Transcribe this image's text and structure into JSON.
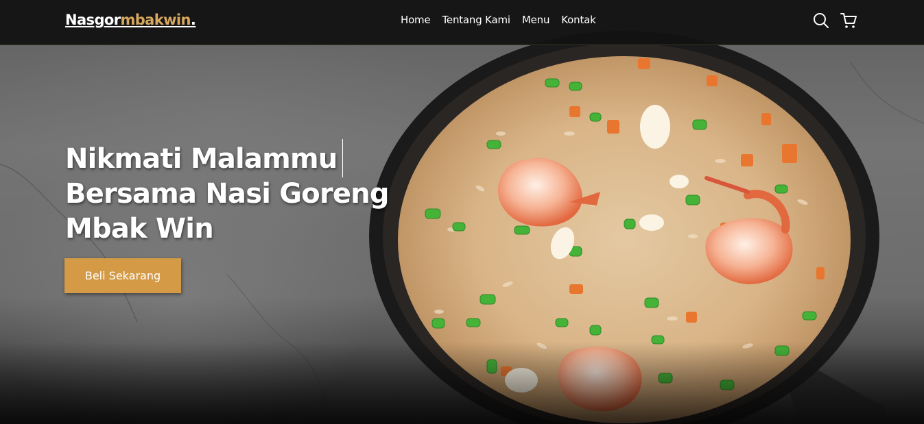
{
  "brand": {
    "primary": "Nasgor",
    "accent": "mbakwin",
    "dot": "."
  },
  "nav": {
    "items": [
      "Home",
      "Tentang Kami",
      "Menu",
      "Kontak"
    ]
  },
  "icons": {
    "search": "search-icon",
    "cart": "cart-icon"
  },
  "hero": {
    "headline_line1": "Nikmati Malammu",
    "headline_line2": "Bersama Nasi Goreng",
    "headline_line3": "Mbak Win",
    "cta_label": "Beli Sekarang"
  },
  "colors": {
    "accent": "#d9a85f",
    "button": "#d49a45",
    "navbar": "#121212"
  }
}
